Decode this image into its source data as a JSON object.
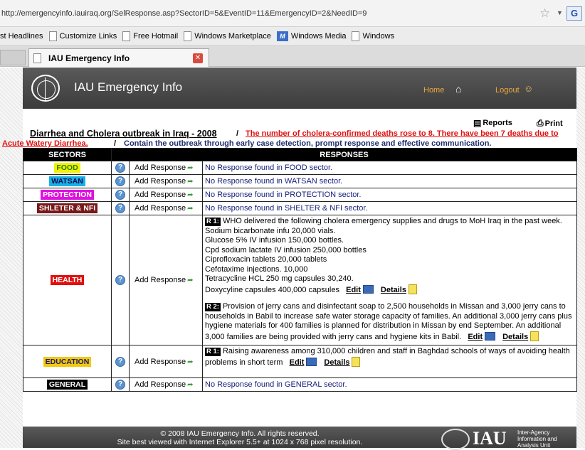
{
  "browser": {
    "url": "http://emergencyinfo.iauiraq.org/SelResponse.asp?SectorID=5&EventID=11&EmergencyID=2&NeedID=9",
    "bookmarks": [
      "st Headlines",
      "Customize Links",
      "Free Hotmail",
      "Windows Marketplace",
      "Windows Media",
      "Windows"
    ],
    "tab_title": "IAU Emergency Info"
  },
  "header": {
    "title": "IAU Emergency Info",
    "home": "Home",
    "logout": "Logout"
  },
  "toolbar": {
    "reports": "Reports",
    "print": "Print"
  },
  "event": {
    "title": "Diarrhea and Cholera outbreak in Iraq - 2008",
    "separator": "/",
    "need_line1": "The number of cholera-confirmed deaths rose to 8. There have been 7 deaths due to",
    "need_line2": "Acute Watery Diarrhea.",
    "objective": "Contain the outbreak through early case detection, prompt response and effective communication."
  },
  "table": {
    "col_sectors": "SECTORS",
    "col_responses": "RESPONSES",
    "add_label": "Add Response",
    "edit_label": "Edit",
    "details_label": "Details",
    "rows": [
      {
        "sector": "FOOD",
        "color": "#f2f200",
        "text_color": "#2a7a10",
        "response": "No Response found in FOOD sector."
      },
      {
        "sector": "WATSAN",
        "color": "#1ab0e6",
        "text_color": "#0a0a4a",
        "response": "No Response found in WATSAN sector."
      },
      {
        "sector": "PROTECTION",
        "color": "#e010e0",
        "text_color": "#ffffff",
        "response": "No Response found in PROTECTION sector."
      },
      {
        "sector": "SHLETER & NFI",
        "color": "#7a1818",
        "text_color": "#ffffff",
        "response": "No Response found in SHELTER & NFI sector."
      },
      {
        "sector": "HEALTH",
        "color": "#e01010",
        "text_color": "#ffffff"
      },
      {
        "sector": "EDUCATION",
        "color": "#f2c810",
        "text_color": "#1a1a6a"
      },
      {
        "sector": "GENERAL",
        "color": "#000000",
        "text_color": "#ffffff",
        "response": "No Response found in GENERAL sector."
      }
    ],
    "health": {
      "r1_id": "R 1:",
      "r1_lines": [
        "WHO delivered the following cholera emergency supplies and drugs to MoH Iraq in the past week.",
        "Sodium bicarbonate infu 20,000 vials.",
        "Glucose 5% IV infusion 150,000 bottles.",
        "Cpd sodium lactate IV infusion 250,000 bottles",
        "Ciprofloxacin tablets 20,000 tablets",
        "Cefotaxime injections. 10,000",
        "Tetracycline HCL 250 mg capsules 30,240.",
        "Doxycyline capsules 400,000 capsules"
      ],
      "r2_id": "R 2:",
      "r2_text": "Provision of jerry cans and disinfectant soap to 2,500 households in Missan and 3,000 jerry cans to households in Babil to increase safe water storage capacity of families. An additional 3,000 jerry cans plus hygiene materials for 400 families is planned for distribution in Missan by end September. An additional 3,000 families are being provided with jerry cans and hygiene kits in Babil."
    },
    "education": {
      "r1_id": "R 1:",
      "r1_text": "Raising awareness among 310,000 children and staff in Baghdad schools of ways of avoiding health problems in short term"
    }
  },
  "footer": {
    "copyright": "© 2008 IAU Emergency Info. All rights reserved.",
    "note": "Site best viewed with Internet Explorer 5.5+ at 1024 x 768 pixel resolution.",
    "logo_text": "IAU",
    "logo_sub1": "Inter-Agency",
    "logo_sub2": "Information and",
    "logo_sub3": "Analysis Unit"
  }
}
